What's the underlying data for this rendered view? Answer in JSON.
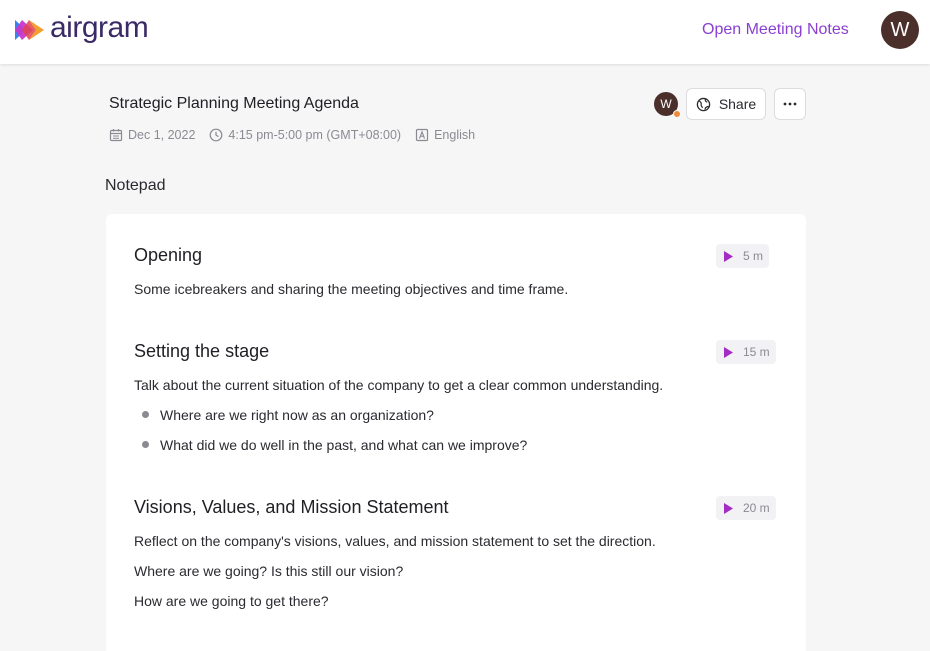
{
  "app": {
    "name": "airgram"
  },
  "header": {
    "open_notes_label": "Open Meeting Notes",
    "user_initial": "W"
  },
  "meeting": {
    "title": "Strategic Planning Meeting Agenda",
    "date": "Dec 1, 2022",
    "time": "4:15 pm-5:00 pm (GMT+08:00)",
    "language": "English",
    "participant_initial": "W",
    "share_label": "Share"
  },
  "notepad": {
    "label": "Notepad",
    "sections": [
      {
        "title": "Opening",
        "duration": "5 m",
        "lines": [
          "Some icebreakers and sharing the meeting objectives and time frame."
        ],
        "bullets": []
      },
      {
        "title": "Setting the stage",
        "duration": "15 m",
        "lines": [
          "Talk about the current situation of the company to get a clear common understanding."
        ],
        "bullets": [
          "Where are we right now as an organization?",
          "What did we do well in the past, and what can we improve?"
        ]
      },
      {
        "title": "Visions, Values, and Mission Statement",
        "duration": "20 m",
        "lines": [
          "Reflect on the company's visions, values, and mission statement to set the direction.",
          "Where are we going? Is this still our vision?",
          "How are we going to get there?"
        ],
        "bullets": []
      }
    ]
  },
  "colors": {
    "accent": "#8a3fd1",
    "avatar": "#4b2f2b",
    "presence": "#f08a3a",
    "play": "#a32cc4"
  },
  "icons": [
    "airgram-logo",
    "calendar-icon",
    "clock-icon",
    "language-icon",
    "globe-icon",
    "more-icon",
    "play-icon"
  ]
}
